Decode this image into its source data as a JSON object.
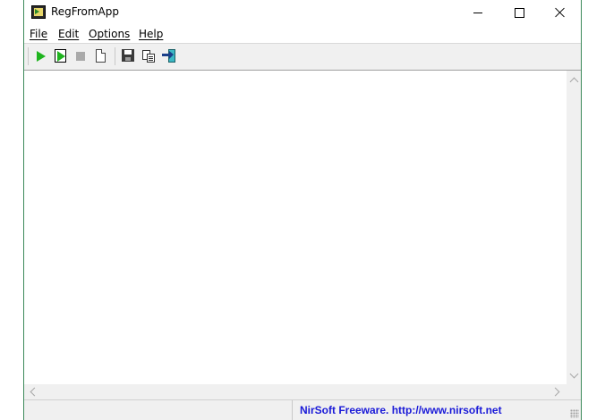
{
  "window": {
    "title": "RegFromApp",
    "icon": "regfromapp-app-icon"
  },
  "title_buttons": {
    "minimize": "minimize-icon",
    "maximize": "maximize-icon",
    "close": "close-icon"
  },
  "menu": {
    "items": [
      {
        "label": "File"
      },
      {
        "label": "Edit"
      },
      {
        "label": "Options"
      },
      {
        "label": "Help"
      }
    ]
  },
  "toolbar": {
    "buttons": [
      {
        "icon": "start-icon"
      },
      {
        "icon": "start-process-icon"
      },
      {
        "icon": "stop-icon"
      },
      {
        "icon": "new-document-icon"
      },
      {
        "icon": "save-icon"
      },
      {
        "icon": "copy-icon"
      },
      {
        "icon": "exit-icon"
      }
    ]
  },
  "statusbar": {
    "link_text": "NirSoft Freeware.  http://www.nirsoft.net",
    "link_color": "#1a1ad8"
  }
}
